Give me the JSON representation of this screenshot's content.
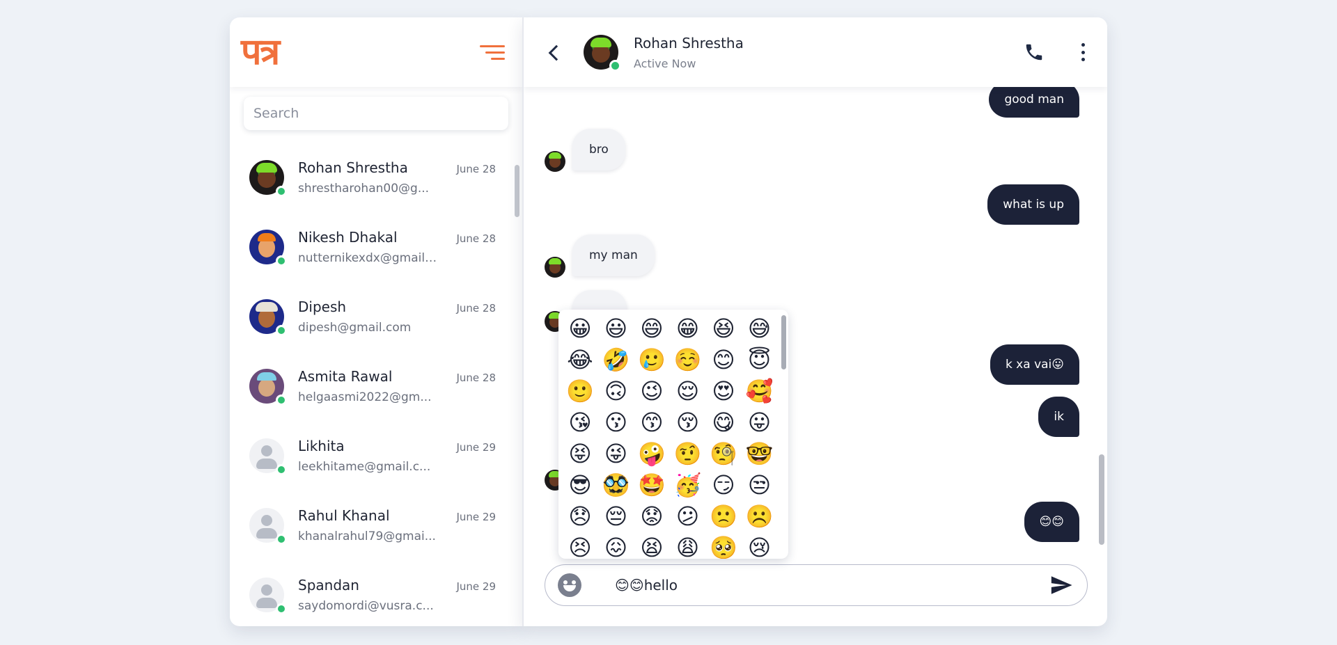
{
  "sidebar": {
    "logo": "पत्र",
    "search_placeholder": "Search",
    "contacts": [
      {
        "name": "Rohan Shrestha",
        "email": "shrestharohan00@g...",
        "date": "June 28"
      },
      {
        "name": "Nikesh Dhakal",
        "email": "nutternikexdx@gmail....",
        "date": "June 28"
      },
      {
        "name": "Dipesh",
        "email": "dipesh@gmail.com",
        "date": "June 28"
      },
      {
        "name": "Asmita Rawal",
        "email": "helgaasmi2022@gm...",
        "date": "June 28"
      },
      {
        "name": "Likhita",
        "email": "leekhitame@gmail.c...",
        "date": "June 29"
      },
      {
        "name": "Rahul Khanal",
        "email": "khanalrahul79@gmai...",
        "date": "June 29"
      },
      {
        "name": "Spandan",
        "email": "saydomordi@vusra.c...",
        "date": "June 29"
      }
    ]
  },
  "chat": {
    "contact_name": "Rohan Shrestha",
    "status": "Active Now",
    "messages": [
      {
        "text": "good man",
        "direction": "outgoing"
      },
      {
        "text": "bro",
        "direction": "incoming"
      },
      {
        "text": "what is up",
        "direction": "outgoing"
      },
      {
        "text": "my man",
        "direction": "incoming"
      },
      {
        "text": "k xa vai😛",
        "direction": "outgoing"
      },
      {
        "text": "ik",
        "direction": "outgoing"
      },
      {
        "text": "😊😊",
        "direction": "outgoing"
      }
    ],
    "composer_value": "😊😊hello"
  },
  "emoji_picker": {
    "emojis": [
      "😀",
      "😃",
      "😄",
      "😁",
      "😆",
      "😅",
      "😂",
      "🤣",
      "🥲",
      "☺️",
      "😊",
      "😇",
      "🙂",
      "🙃",
      "😉",
      "😌",
      "😍",
      "🥰",
      "😘",
      "😗",
      "😙",
      "😚",
      "😋",
      "😛",
      "😝",
      "😜",
      "🤪",
      "🤨",
      "🧐",
      "🤓",
      "😎",
      "🥸",
      "🤩",
      "🥳",
      "😏",
      "😒",
      "😞",
      "😔",
      "😟",
      "😕",
      "🙁",
      "☹️",
      "😣",
      "😖",
      "😫",
      "😩",
      "🥺",
      "😢"
    ]
  },
  "colors": {
    "accent": "#f0703c",
    "outgoing_bubble": "#1c2238",
    "online": "#2fbf71",
    "background": "#eef2f7"
  },
  "icons": {
    "menu": "hamburger-icon",
    "back": "chevron-left-icon",
    "call": "phone-icon",
    "more": "kebab-icon",
    "emoji": "smiley-icon",
    "send": "send-icon"
  }
}
